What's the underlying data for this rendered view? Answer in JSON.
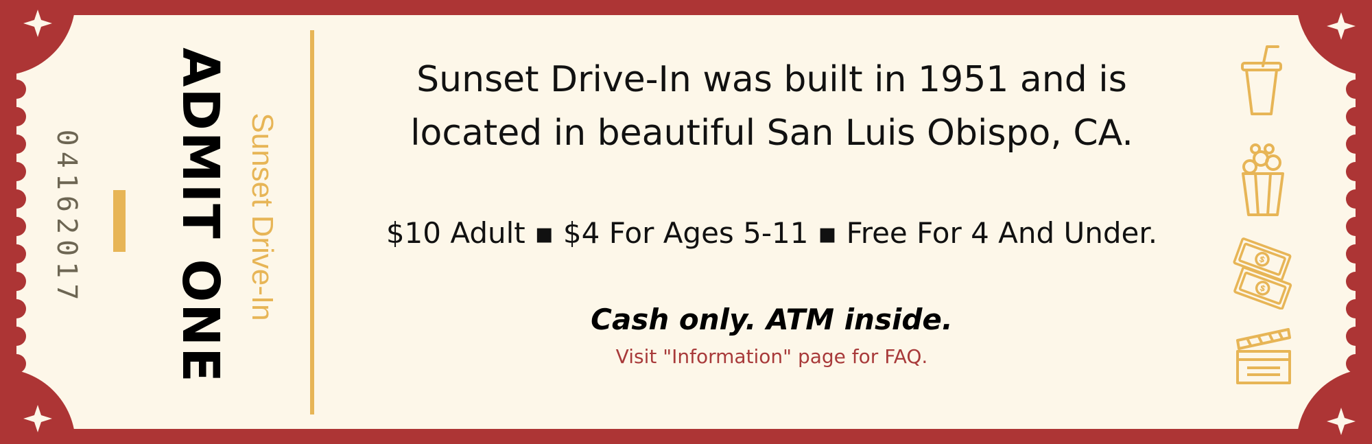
{
  "ticket": {
    "serial": "04162017",
    "admit": "ADMIT ONE",
    "venue": "Sunset Drive-In",
    "description_line_1": "Sunset Drive-In was built in 1951 and is",
    "description_line_2": "located in beautiful San Luis Obispo, CA.",
    "prices": "$10 Adult ▪ $4 For Ages 5-11 ▪ Free For 4 And Under.",
    "cash_note": "Cash only. ATM inside.",
    "faq_note": "Visit \"Information\" page for FAQ."
  },
  "icons": [
    "soda-cup-icon",
    "popcorn-icon",
    "money-icon",
    "clapperboard-icon",
    "star-icon"
  ],
  "colors": {
    "border": "#ad3535",
    "paper": "#fdf7e9",
    "accent": "#e7b556",
    "link_red": "#a83a3a",
    "text": "#111111"
  }
}
